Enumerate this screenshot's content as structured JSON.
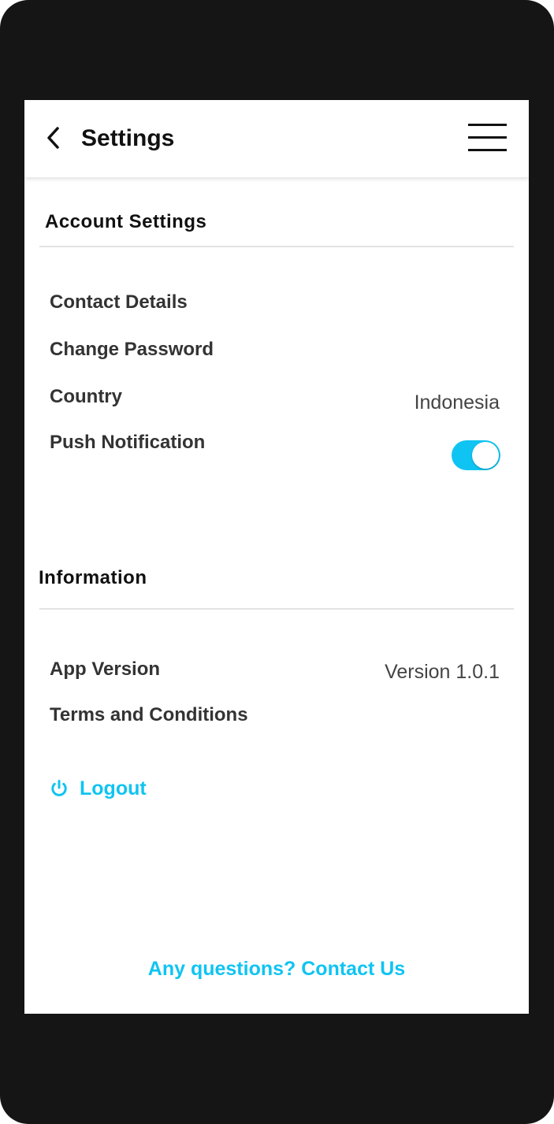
{
  "header": {
    "title": "Settings",
    "back_icon": "chevron-left-icon",
    "menu_icon": "hamburger-menu-icon"
  },
  "account_settings": {
    "title": "Account Settings",
    "items": [
      {
        "label": "Contact Details"
      },
      {
        "label": "Change Password"
      },
      {
        "label": "Country",
        "value": "Indonesia"
      },
      {
        "label": "Push Notification",
        "toggle_on": true
      }
    ]
  },
  "information": {
    "title": "Information",
    "items": [
      {
        "label": "App Version",
        "value": "Version 1.0.1"
      },
      {
        "label": "Terms and Conditions"
      }
    ]
  },
  "logout": {
    "label": "Logout",
    "icon": "power-icon"
  },
  "footer": {
    "contact_link": "Any questions? Contact Us"
  },
  "colors": {
    "accent": "#0fc4f2",
    "frame": "#151515",
    "text_primary": "#111111",
    "text_secondary": "#333333"
  }
}
